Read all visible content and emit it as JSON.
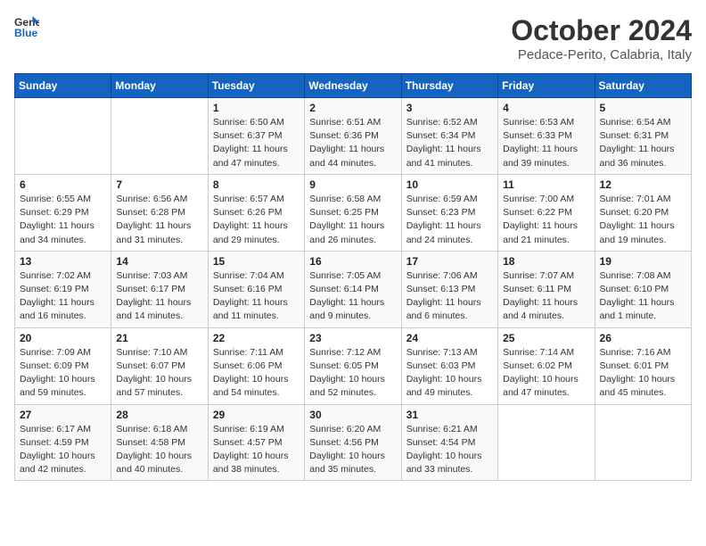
{
  "logo": {
    "line1": "General",
    "line2": "Blue"
  },
  "title": "October 2024",
  "subtitle": "Pedace-Perito, Calabria, Italy",
  "days_header": [
    "Sunday",
    "Monday",
    "Tuesday",
    "Wednesday",
    "Thursday",
    "Friday",
    "Saturday"
  ],
  "weeks": [
    [
      {
        "num": "",
        "info": ""
      },
      {
        "num": "",
        "info": ""
      },
      {
        "num": "1",
        "info": "Sunrise: 6:50 AM\nSunset: 6:37 PM\nDaylight: 11 hours and 47 minutes."
      },
      {
        "num": "2",
        "info": "Sunrise: 6:51 AM\nSunset: 6:36 PM\nDaylight: 11 hours and 44 minutes."
      },
      {
        "num": "3",
        "info": "Sunrise: 6:52 AM\nSunset: 6:34 PM\nDaylight: 11 hours and 41 minutes."
      },
      {
        "num": "4",
        "info": "Sunrise: 6:53 AM\nSunset: 6:33 PM\nDaylight: 11 hours and 39 minutes."
      },
      {
        "num": "5",
        "info": "Sunrise: 6:54 AM\nSunset: 6:31 PM\nDaylight: 11 hours and 36 minutes."
      }
    ],
    [
      {
        "num": "6",
        "info": "Sunrise: 6:55 AM\nSunset: 6:29 PM\nDaylight: 11 hours and 34 minutes."
      },
      {
        "num": "7",
        "info": "Sunrise: 6:56 AM\nSunset: 6:28 PM\nDaylight: 11 hours and 31 minutes."
      },
      {
        "num": "8",
        "info": "Sunrise: 6:57 AM\nSunset: 6:26 PM\nDaylight: 11 hours and 29 minutes."
      },
      {
        "num": "9",
        "info": "Sunrise: 6:58 AM\nSunset: 6:25 PM\nDaylight: 11 hours and 26 minutes."
      },
      {
        "num": "10",
        "info": "Sunrise: 6:59 AM\nSunset: 6:23 PM\nDaylight: 11 hours and 24 minutes."
      },
      {
        "num": "11",
        "info": "Sunrise: 7:00 AM\nSunset: 6:22 PM\nDaylight: 11 hours and 21 minutes."
      },
      {
        "num": "12",
        "info": "Sunrise: 7:01 AM\nSunset: 6:20 PM\nDaylight: 11 hours and 19 minutes."
      }
    ],
    [
      {
        "num": "13",
        "info": "Sunrise: 7:02 AM\nSunset: 6:19 PM\nDaylight: 11 hours and 16 minutes."
      },
      {
        "num": "14",
        "info": "Sunrise: 7:03 AM\nSunset: 6:17 PM\nDaylight: 11 hours and 14 minutes."
      },
      {
        "num": "15",
        "info": "Sunrise: 7:04 AM\nSunset: 6:16 PM\nDaylight: 11 hours and 11 minutes."
      },
      {
        "num": "16",
        "info": "Sunrise: 7:05 AM\nSunset: 6:14 PM\nDaylight: 11 hours and 9 minutes."
      },
      {
        "num": "17",
        "info": "Sunrise: 7:06 AM\nSunset: 6:13 PM\nDaylight: 11 hours and 6 minutes."
      },
      {
        "num": "18",
        "info": "Sunrise: 7:07 AM\nSunset: 6:11 PM\nDaylight: 11 hours and 4 minutes."
      },
      {
        "num": "19",
        "info": "Sunrise: 7:08 AM\nSunset: 6:10 PM\nDaylight: 11 hours and 1 minute."
      }
    ],
    [
      {
        "num": "20",
        "info": "Sunrise: 7:09 AM\nSunset: 6:09 PM\nDaylight: 10 hours and 59 minutes."
      },
      {
        "num": "21",
        "info": "Sunrise: 7:10 AM\nSunset: 6:07 PM\nDaylight: 10 hours and 57 minutes."
      },
      {
        "num": "22",
        "info": "Sunrise: 7:11 AM\nSunset: 6:06 PM\nDaylight: 10 hours and 54 minutes."
      },
      {
        "num": "23",
        "info": "Sunrise: 7:12 AM\nSunset: 6:05 PM\nDaylight: 10 hours and 52 minutes."
      },
      {
        "num": "24",
        "info": "Sunrise: 7:13 AM\nSunset: 6:03 PM\nDaylight: 10 hours and 49 minutes."
      },
      {
        "num": "25",
        "info": "Sunrise: 7:14 AM\nSunset: 6:02 PM\nDaylight: 10 hours and 47 minutes."
      },
      {
        "num": "26",
        "info": "Sunrise: 7:16 AM\nSunset: 6:01 PM\nDaylight: 10 hours and 45 minutes."
      }
    ],
    [
      {
        "num": "27",
        "info": "Sunrise: 6:17 AM\nSunset: 4:59 PM\nDaylight: 10 hours and 42 minutes."
      },
      {
        "num": "28",
        "info": "Sunrise: 6:18 AM\nSunset: 4:58 PM\nDaylight: 10 hours and 40 minutes."
      },
      {
        "num": "29",
        "info": "Sunrise: 6:19 AM\nSunset: 4:57 PM\nDaylight: 10 hours and 38 minutes."
      },
      {
        "num": "30",
        "info": "Sunrise: 6:20 AM\nSunset: 4:56 PM\nDaylight: 10 hours and 35 minutes."
      },
      {
        "num": "31",
        "info": "Sunrise: 6:21 AM\nSunset: 4:54 PM\nDaylight: 10 hours and 33 minutes."
      },
      {
        "num": "",
        "info": ""
      },
      {
        "num": "",
        "info": ""
      }
    ]
  ]
}
